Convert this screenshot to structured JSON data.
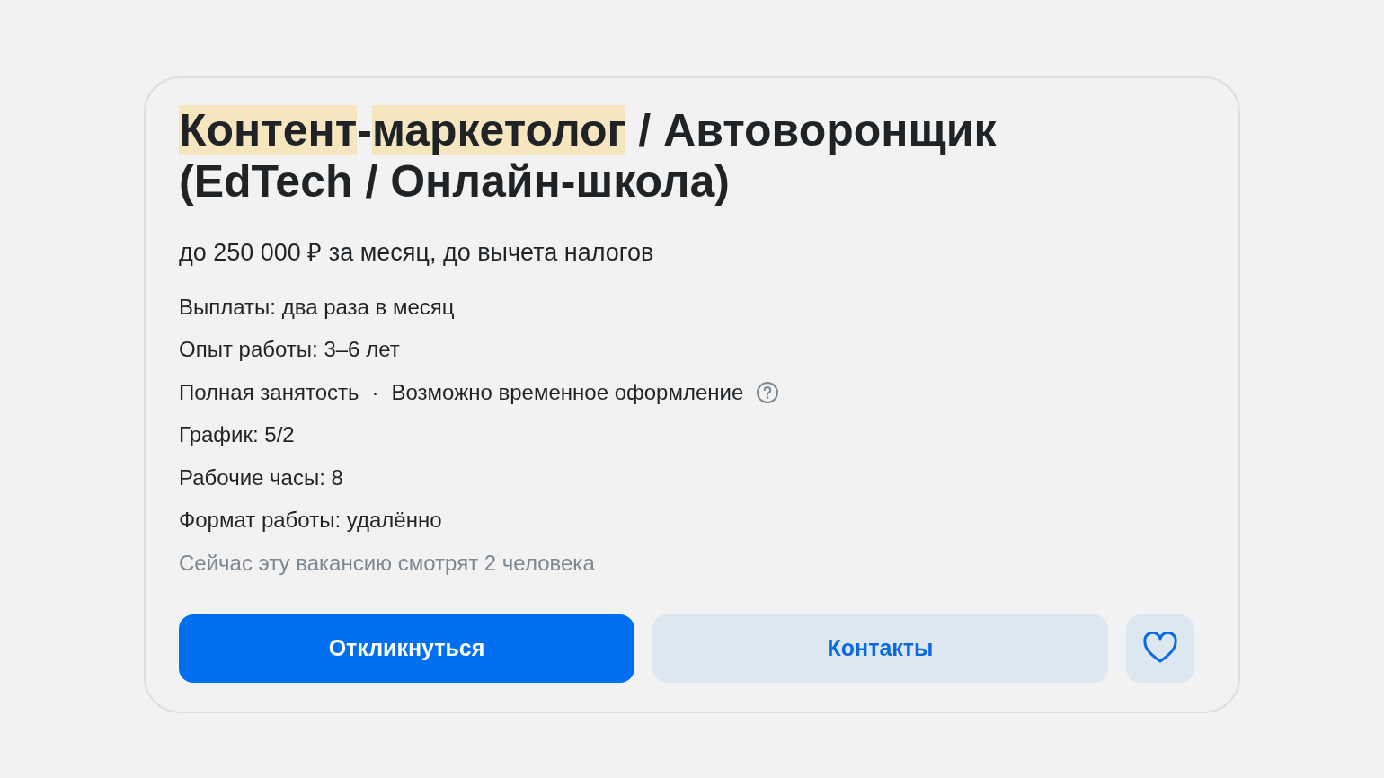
{
  "vacancy": {
    "title": [
      {
        "text": "Контент",
        "highlighted": true
      },
      {
        "text": "-",
        "highlighted": false
      },
      {
        "text": "маркетолог",
        "highlighted": true
      },
      {
        "text": " / Автоворонщик (EdTech / Онлайн-школа)",
        "highlighted": false
      }
    ],
    "salary": "до 250 000 ₽ за месяц, до вычета налогов",
    "details": [
      {
        "kind": "plain",
        "text": "Выплаты: два раза в месяц"
      },
      {
        "kind": "plain",
        "text": "Опыт работы: 3–6 лет"
      },
      {
        "kind": "multi",
        "parts": [
          "Полная занятость",
          "·",
          "Возможно временное оформление"
        ],
        "help": true
      },
      {
        "kind": "plain",
        "text": "График: 5/2"
      },
      {
        "kind": "plain",
        "text": "Рабочие часы: 8"
      },
      {
        "kind": "plain",
        "text": "Формат работы: удалённо"
      }
    ],
    "viewers": "Сейчас эту вакансию смотрят 2 человека",
    "buttons": [
      {
        "kind": "primary",
        "label": "Откликнуться"
      },
      {
        "kind": "secondary",
        "label": "Контакты"
      }
    ],
    "favorite": {
      "selected": false
    }
  }
}
